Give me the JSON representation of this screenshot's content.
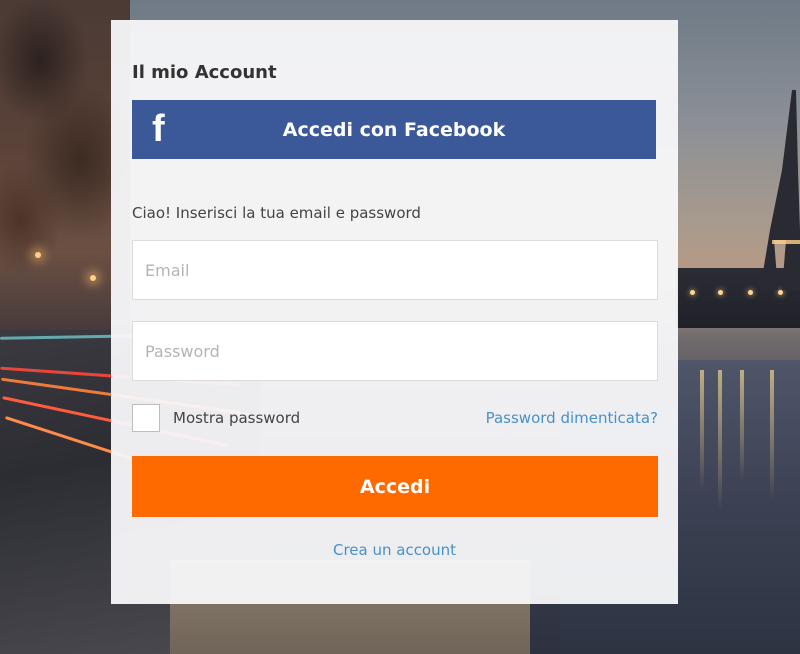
{
  "panel": {
    "title": "Il mio Account",
    "facebook": {
      "icon": "f",
      "label": "Accedi con Facebook",
      "color": "#3b5998"
    },
    "intro": "Ciao! Inserisci la tua email e password",
    "email": {
      "placeholder": "Email",
      "value": ""
    },
    "password": {
      "placeholder": "Password",
      "value": ""
    },
    "show_password": {
      "label": "Mostra password",
      "checked": false
    },
    "forgot_link": "Password dimenticata?",
    "login_button": {
      "label": "Accedi",
      "color": "#ff6a00"
    },
    "create_link": "Crea un account"
  },
  "colors": {
    "link": "#4a90c8",
    "panel_bg": "#f8f8fa"
  }
}
